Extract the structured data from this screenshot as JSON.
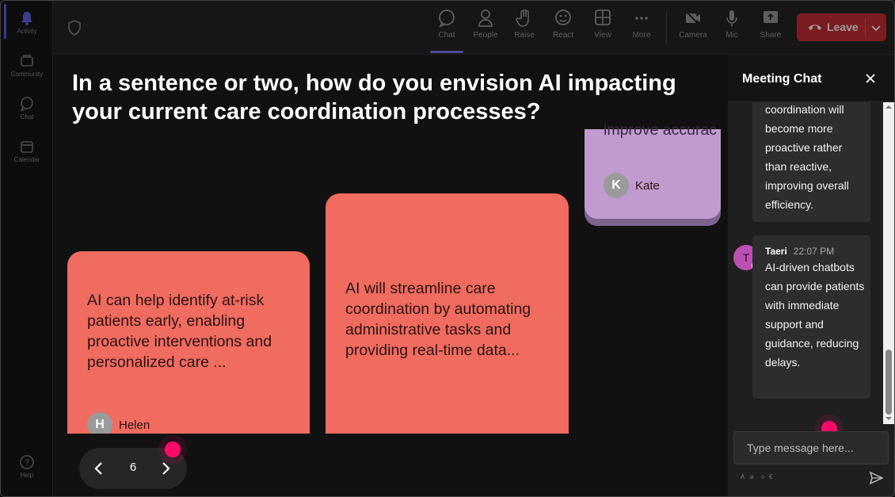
{
  "rail": {
    "items": [
      {
        "label": "Activity",
        "icon": "bell-icon"
      },
      {
        "label": "Community",
        "icon": "community-icon"
      },
      {
        "label": "Chat",
        "icon": "chat-icon"
      },
      {
        "label": "Calendar",
        "icon": "calendar-icon"
      },
      {
        "label": "Help",
        "icon": "help-icon"
      }
    ]
  },
  "toolbar": {
    "chat": "Chat",
    "people": "People",
    "raise": "Raise",
    "react": "React",
    "view": "View",
    "more": "More",
    "camera": "Camera",
    "mic": "Mic",
    "share": "Share",
    "leave": "Leave"
  },
  "stage": {
    "question": "In a sentence or two, how do you envision AI impacting your current care coordination processes?",
    "cards": [
      {
        "text": "AI can help identify at-risk patients early, enabling proactive interventions and personalized care ...",
        "author": "Helen",
        "initial": "H"
      },
      {
        "text": "AI will streamline care coordination by automating administrative tasks and providing real-time data...",
        "author": "",
        "initial": ""
      },
      {
        "text": "improve accurac",
        "author": "Kate",
        "initial": "K"
      }
    ],
    "pager": {
      "page": "6"
    }
  },
  "chat": {
    "title": "Meeting Chat",
    "messages": [
      {
        "sender": "",
        "time": "",
        "text": "coordination will become more proactive rather than reactive, improving overall efficiency."
      },
      {
        "sender": "Taeri",
        "time": "22:07 PM",
        "initial": "T",
        "text": "AI-driven chatbots can provide patients with immediate support and guidance, reducing delays."
      }
    ],
    "input_placeholder": "Type message here..."
  },
  "colors": {
    "card_coral": "#f06b60",
    "card_purple": "#c19ad0",
    "leave_red": "#7a1c20",
    "pointer_pink": "#ff0a68",
    "avatar_magenta": "#bd4fb2"
  }
}
